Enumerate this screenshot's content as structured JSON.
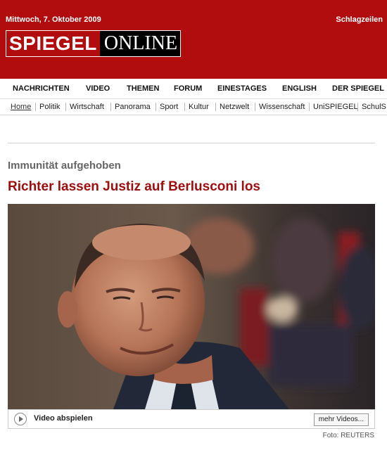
{
  "header": {
    "date": "Mittwoch, 7. Oktober 2009",
    "schlagzeilen": "Schlagzeilen",
    "logo_spiegel": "SPIEGEL",
    "logo_online": "ONLINE"
  },
  "main_nav": [
    "NACHRICHTEN",
    "VIDEO",
    "THEMEN",
    "FORUM",
    "EINESTAGES",
    "ENGLISH",
    "DER SPIEGEL"
  ],
  "sub_nav": [
    "Home",
    "Politik",
    "Wirtschaft",
    "Panorama",
    "Sport",
    "Kultur",
    "Netzwelt",
    "Wissenschaft",
    "UniSPIEGEL",
    "SchulS"
  ],
  "article": {
    "kicker": "Immunität aufgehoben",
    "headline": "Richter lassen Justiz auf Berlusconi los",
    "video_label": "Video abspielen",
    "more_videos": "mehr Videos...",
    "credit": "Foto: REUTERS"
  },
  "colors": {
    "brand_red": "#b10d0f",
    "headline_red": "#9c0d0d"
  },
  "icons": {
    "play": "play-icon"
  }
}
